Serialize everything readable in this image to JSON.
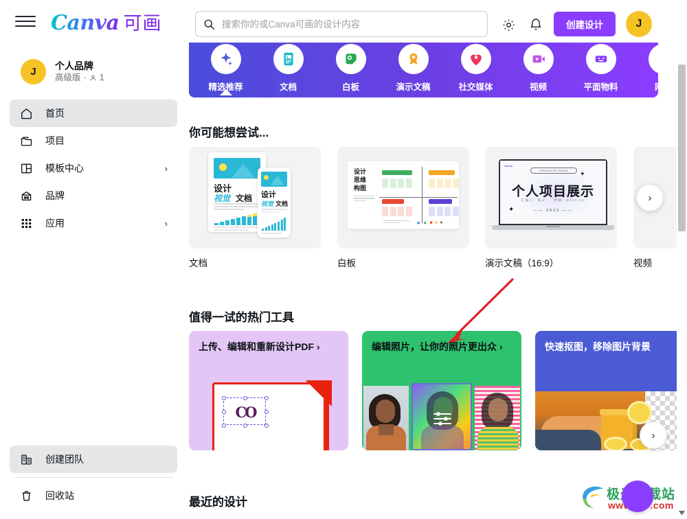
{
  "header": {
    "menu_icon": "hamburger-icon",
    "logo_text": "Canva",
    "logo_cn": "可画",
    "search": {
      "placeholder": "搜索你的或Canva可画的设计内容",
      "value": "",
      "icon": "search-icon"
    },
    "settings_icon": "gear-icon",
    "notifications_icon": "bell-icon",
    "create_button": "创建设计",
    "avatar_initial": "J",
    "accent_color": "#8b3dff",
    "avatar_color": "#f5c324"
  },
  "sidebar": {
    "brand": {
      "avatar_initial": "J",
      "name": "个人品牌",
      "plan": "高级版",
      "separator": "·",
      "members_icon": "person-icon",
      "members_count": "1"
    },
    "items": [
      {
        "label": "首页",
        "icon": "home-icon",
        "active": true,
        "chevron": false
      },
      {
        "label": "项目",
        "icon": "folder-icon",
        "active": false,
        "chevron": false
      },
      {
        "label": "模板中心",
        "icon": "template-icon",
        "active": false,
        "chevron": true
      },
      {
        "label": "品牌",
        "icon": "brand-kit-icon",
        "active": false,
        "chevron": false
      },
      {
        "label": "应用",
        "icon": "apps-grid-icon",
        "active": false,
        "chevron": true
      }
    ],
    "bottom_items": [
      {
        "label": "创建团队",
        "icon": "building-icon",
        "active": true
      },
      {
        "label": "回收站",
        "icon": "trash-icon",
        "active": false
      }
    ]
  },
  "categories": [
    {
      "label": "精选推荐",
      "icon": "sparkle-icon",
      "color": "#4a5bd4",
      "active": true
    },
    {
      "label": "文档",
      "icon": "document-icon",
      "color": "#19b8c6",
      "active": false
    },
    {
      "label": "白板",
      "icon": "whiteboard-icon",
      "color": "#23a94f",
      "active": false
    },
    {
      "label": "演示文稿",
      "icon": "presentation-icon",
      "color": "#f5a220",
      "active": false
    },
    {
      "label": "社交媒体",
      "icon": "social-media-icon",
      "color": "#f0375a",
      "active": false
    },
    {
      "label": "视频",
      "icon": "video-icon",
      "color": "#c055e8",
      "active": false
    },
    {
      "label": "平面物料",
      "icon": "print-material-icon",
      "color": "#8b3dff",
      "active": false
    },
    {
      "label": "网站",
      "icon": "website-icon",
      "color": "#19b8c6",
      "active": false
    }
  ],
  "try_section": {
    "title": "你可能想尝试...",
    "cards": [
      {
        "label": "文档",
        "thumb": "doc-visual-thumb",
        "thumb_text": {
          "line1": "设计",
          "line2a": "视觉",
          "line2b": "文档"
        }
      },
      {
        "label": "白板",
        "thumb": "whiteboard-thumb",
        "thumb_text": {
          "line1": "设计",
          "line2": "思维",
          "line3": "构图"
        }
      },
      {
        "label": "演示文稿（16:9）",
        "thumb": "presentation-thumb",
        "thumb_text": {
          "badge": "PROJECTS SHOW",
          "title": "个人项目展示",
          "year": "2023"
        }
      },
      {
        "label": "视频",
        "thumb": "video-thumb",
        "thumb_text": {}
      }
    ],
    "next_button": "chevron-right-icon"
  },
  "tools_section": {
    "title": "值得一试的热门工具",
    "cards": [
      {
        "title": "上传、编辑和重新设计PDF ›",
        "bg": "#e3c6f5",
        "text_color": "#0d1216",
        "art": "pdf-edit-art"
      },
      {
        "title": "编辑照片，让你的照片更出众 ›",
        "bg": "#2fc26e",
        "text_color": "#0d1216",
        "art": "photo-edit-art"
      },
      {
        "title": "快速抠图，移除图片背景",
        "bg": "#4a5bd4",
        "text_color": "#ffffff",
        "art": "bg-remove-art"
      }
    ],
    "next_button": "chevron-right-icon"
  },
  "recent_section": {
    "title": "最近的设计"
  },
  "annotation": {
    "type": "red-arrow",
    "color": "#e02020"
  },
  "watermark": {
    "line1": "极光下载站",
    "line2": "www.xz7.com"
  },
  "scrollbar": {
    "thumb_color": "#c1c1c1"
  }
}
